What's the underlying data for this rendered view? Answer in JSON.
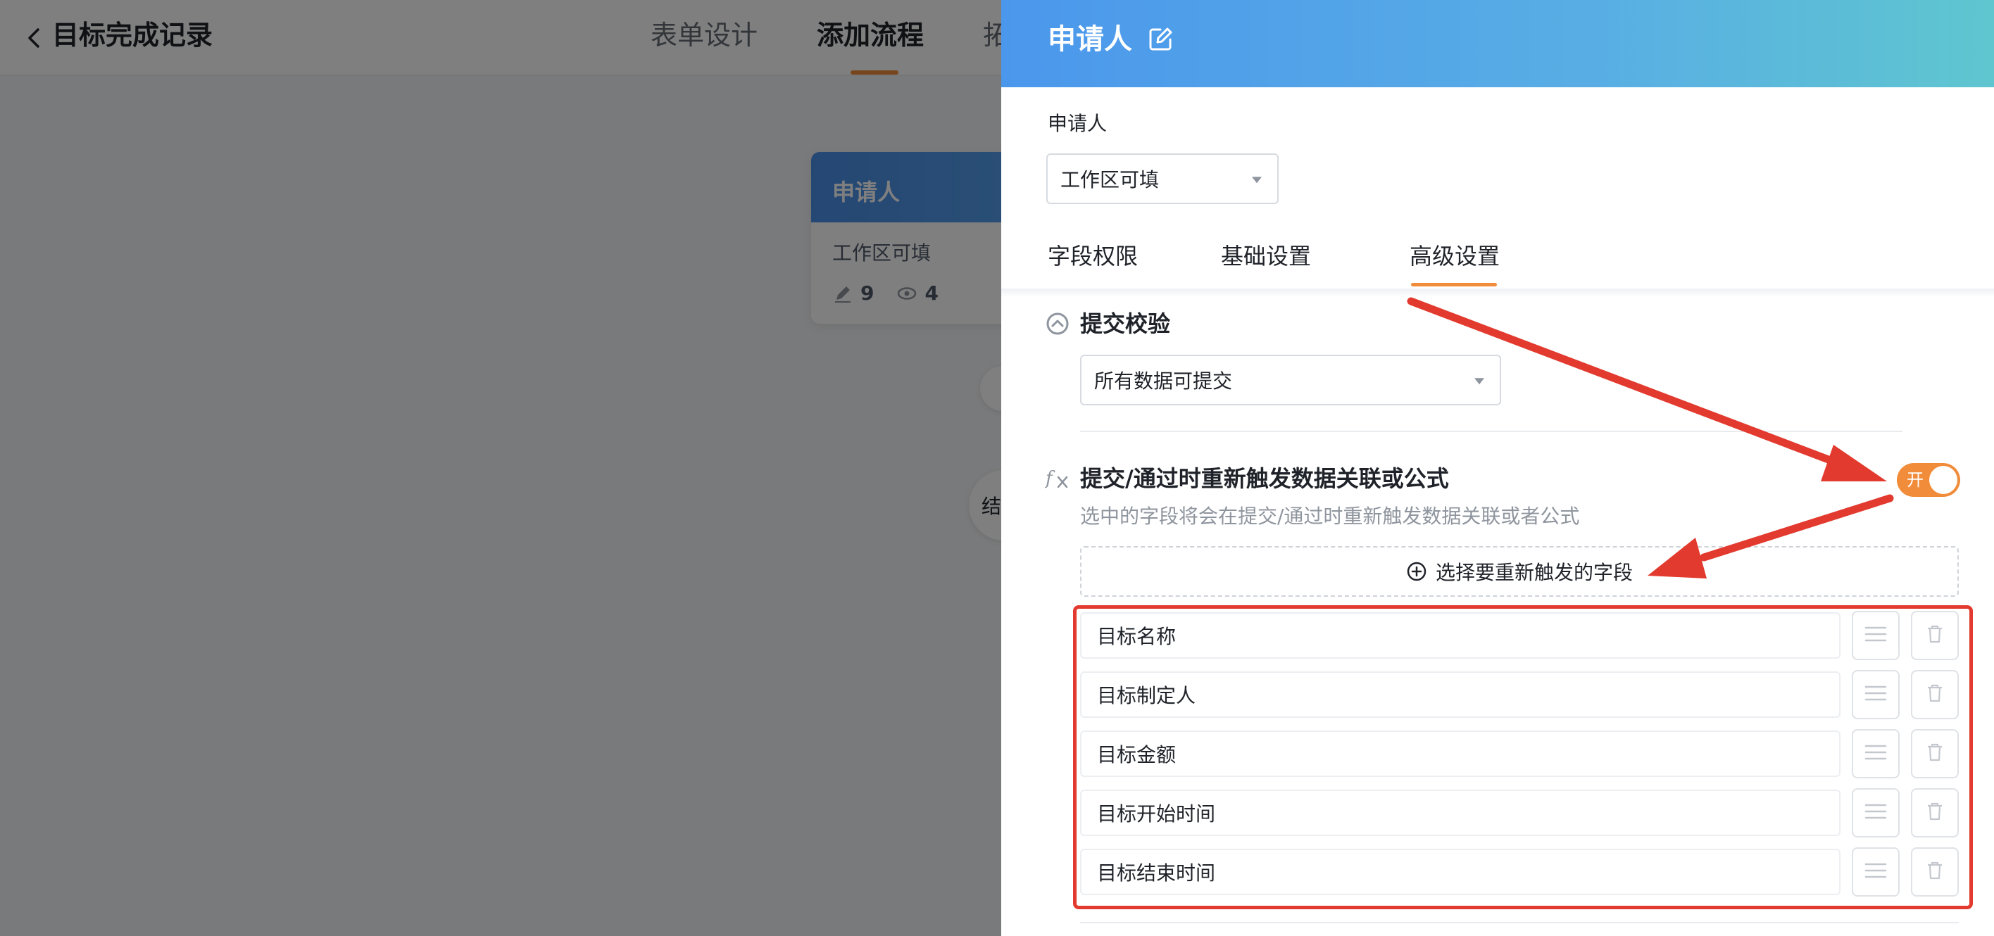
{
  "background": {
    "app_title": "目标完成记录",
    "top_tabs": [
      {
        "label": "表单设计"
      },
      {
        "label": "添加流程"
      },
      {
        "label": "拓"
      }
    ],
    "node_card": {
      "title": "申请人",
      "subtitle": "工作区可填",
      "edit_count": "9",
      "view_count": "4"
    },
    "end_node_label": "结"
  },
  "drawer": {
    "title": "申请人",
    "field_label": "申请人",
    "permission_select": {
      "value": "工作区可填"
    },
    "tabs": [
      {
        "label": "字段权限"
      },
      {
        "label": "基础设置"
      },
      {
        "label": "高级设置",
        "active": true
      }
    ],
    "submit_check": {
      "title": "提交校验",
      "select_value": "所有数据可提交"
    },
    "retrigger": {
      "title": "提交/通过时重新触发数据关联或公式",
      "description": "选中的字段将会在提交/通过时重新触发数据关联或者公式",
      "toggle_label": "开",
      "toggle_on": true,
      "add_button_label": "选择要重新触发的字段",
      "fields": [
        {
          "name": "目标名称"
        },
        {
          "name": "目标制定人"
        },
        {
          "name": "目标金额"
        },
        {
          "name": "目标开始时间"
        },
        {
          "name": "目标结束时间"
        }
      ]
    }
  },
  "colors": {
    "accent": "#f08c3a",
    "header_gradient_start": "#4b97ec",
    "header_gradient_end": "#5fc6cf",
    "annotation_red": "#e23a2e"
  }
}
